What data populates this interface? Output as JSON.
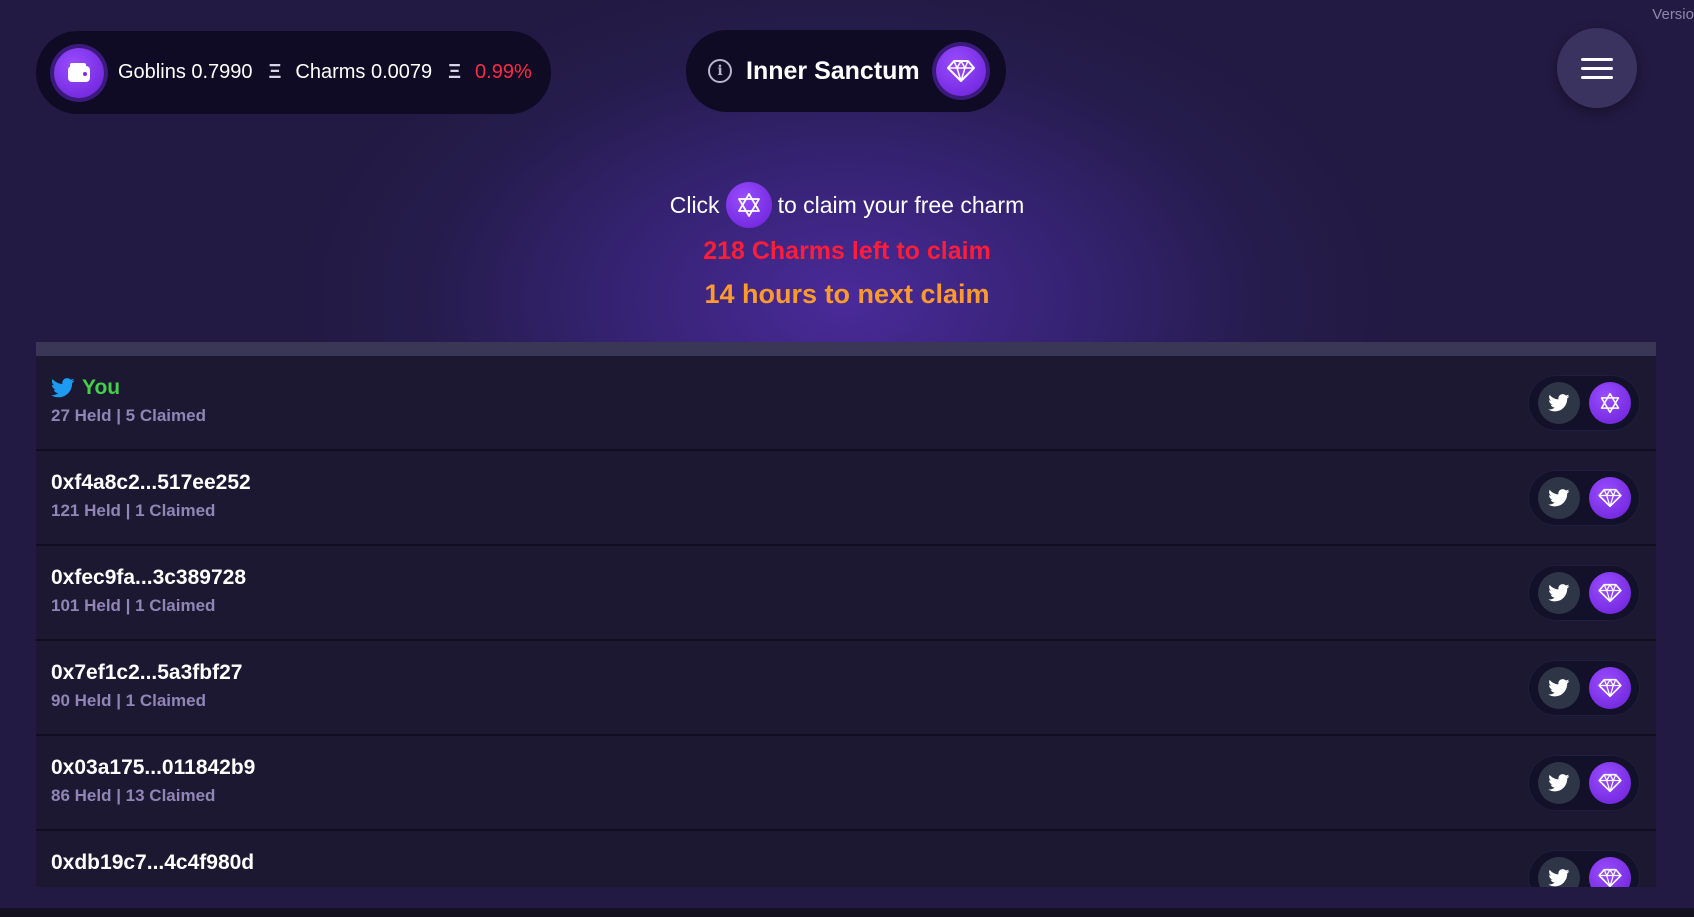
{
  "version_label": "Versio",
  "header": {
    "goblins": "Goblins 0.7990",
    "charms": "Charms 0.0079",
    "eth_symbol": "Ξ",
    "percent": "0.99%",
    "title": "Inner Sanctum",
    "info_symbol": "i"
  },
  "claim": {
    "prefix": "Click",
    "suffix": "to claim your free charm",
    "charms_left": "218 Charms left to claim",
    "next_claim": "14 hours to next claim"
  },
  "rows": [
    {
      "name": "You",
      "stats": "27 Held | 5 Claimed"
    },
    {
      "name": "0xf4a8c2...517ee252",
      "stats": "121 Held | 1 Claimed"
    },
    {
      "name": "0xfec9fa...3c389728",
      "stats": "101 Held | 1 Claimed"
    },
    {
      "name": "0x7ef1c2...5a3fbf27",
      "stats": "90 Held | 1 Claimed"
    },
    {
      "name": "0x03a175...011842b9",
      "stats": "86 Held | 13 Claimed"
    },
    {
      "name": "0xdb19c7...4c4f980d",
      "stats": ""
    }
  ],
  "colors": {
    "accent": "#7a2cf0",
    "you": "#43d04a",
    "warning_red": "#ff1d3a",
    "warning_orange": "#ff9a2e"
  },
  "icons": {
    "wallet": "wallet-icon",
    "info": "info-icon",
    "gem": "gem-icon",
    "menu": "hamburger-menu-icon",
    "star": "star-of-david-icon",
    "twitter": "twitter-icon"
  }
}
